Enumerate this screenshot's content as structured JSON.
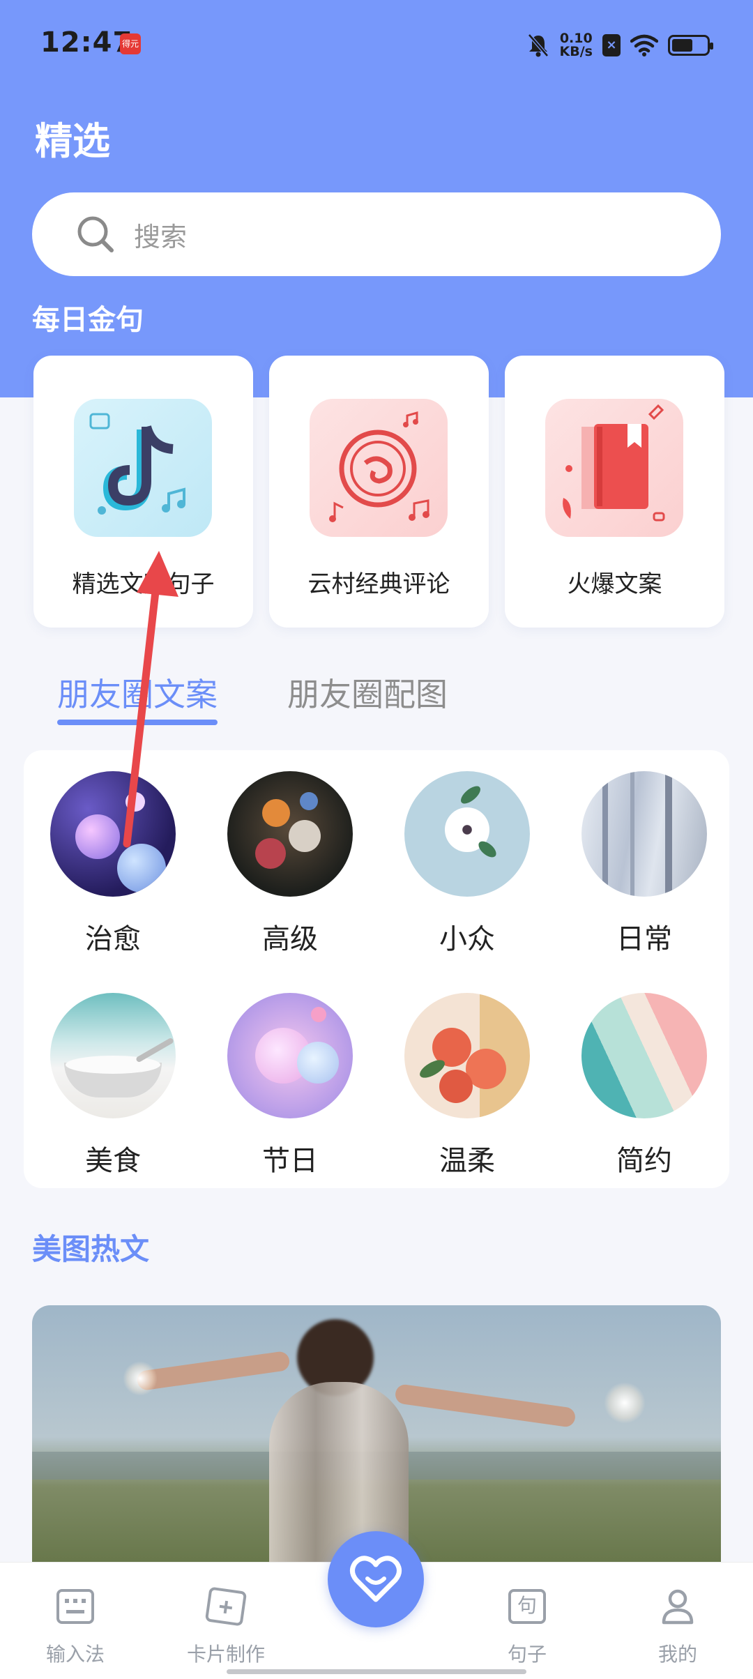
{
  "status_bar": {
    "time": "12:47",
    "app_badge": "得元",
    "net_speed_value": "0.10",
    "net_speed_unit": "KB/s",
    "battery_percent": 60
  },
  "header": {
    "title": "精选"
  },
  "search": {
    "placeholder": "搜索"
  },
  "daily": {
    "title": "每日金句",
    "cards": [
      {
        "label": "精选文案句子",
        "icon": "tiktok-note-icon"
      },
      {
        "label": "云村经典评论",
        "icon": "vinyl-record-icon"
      },
      {
        "label": "火爆文案",
        "icon": "notebook-icon"
      }
    ]
  },
  "tabs": [
    {
      "label": "朋友圈文案",
      "active": true
    },
    {
      "label": "朋友圈配图",
      "active": false
    }
  ],
  "categories": [
    {
      "label": "治愈"
    },
    {
      "label": "高级"
    },
    {
      "label": "小众"
    },
    {
      "label": "日常"
    },
    {
      "label": "美食"
    },
    {
      "label": "节日"
    },
    {
      "label": "温柔"
    },
    {
      "label": "简约"
    }
  ],
  "hot": {
    "title": "美图热文"
  },
  "bottom_nav": [
    {
      "label": "输入法",
      "icon": "keyboard-icon"
    },
    {
      "label": "卡片制作",
      "icon": "card-add-icon"
    },
    {
      "label": "",
      "icon": "heart-icon"
    },
    {
      "label": "句子",
      "icon": "sentence-icon"
    },
    {
      "label": "我的",
      "icon": "person-icon"
    }
  ],
  "colors": {
    "header_blue": "#7798fb",
    "accent": "#6b8ef8",
    "annotation_red": "#e8474a"
  }
}
